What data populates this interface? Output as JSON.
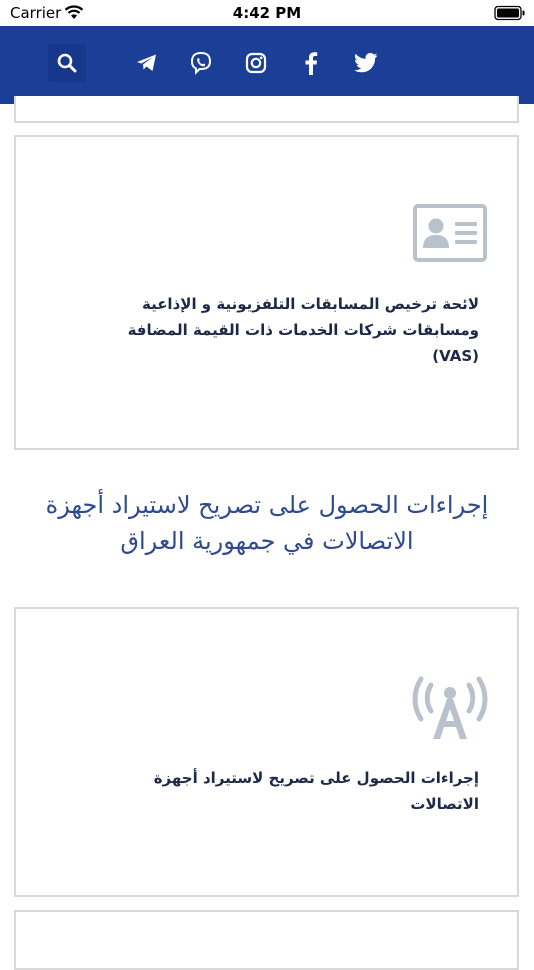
{
  "status_bar": {
    "carrier": "Carrier",
    "time": "4:42 PM"
  },
  "header": {
    "background_color": "#1b3f96",
    "icons": [
      "search-icon",
      "telegram-icon",
      "viber-icon",
      "instagram-icon",
      "facebook-icon",
      "twitter-icon"
    ]
  },
  "cards": [
    {
      "icon": "id-card-icon",
      "title_lines": [
        "لائحة ترخيص المسابقات التلفزيونية و الإذاعية",
        "ومسابقات شركات الخدمات ذات القيمة المضافة",
        "(VAS)"
      ]
    },
    {
      "icon": "antenna-icon",
      "title_lines": [
        "إجراءات الحصول على تصريح لاستيراد أجهزة",
        "الاتصالات"
      ]
    }
  ],
  "section": {
    "heading_lines": [
      "إجراءات الحصول على تصريح لاستيراد أجهزة",
      "الاتصالات في جمهورية العراق"
    ]
  },
  "colors": {
    "heading": "#2f4a8f",
    "card_title": "#1c2a47",
    "icon": "#b9c1cc",
    "card_border": "#d8d8d8"
  }
}
